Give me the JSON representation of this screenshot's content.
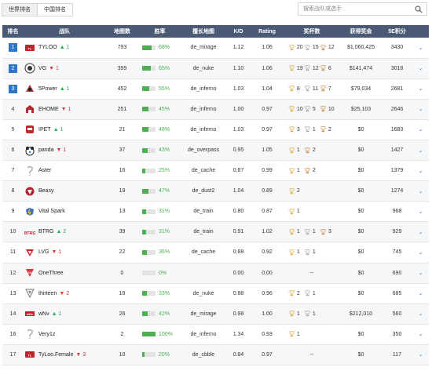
{
  "tabs": {
    "world": "世界排名",
    "china": "中国排名"
  },
  "search": {
    "placeholder": "搜索战队或选手"
  },
  "columns": {
    "rank": "排名",
    "team": "战队",
    "maps": "地图数",
    "winrate": "胜率",
    "best_map": "擅长地图",
    "kd": "K/D",
    "rating": "Rating",
    "trophies": "奖杯数",
    "prize": "获得奖金",
    "points": "5E积分"
  },
  "colors": {
    "header_bg": "#4a5a75",
    "rank_badge": "#2e76c6",
    "up": "#2fa84f",
    "down": "#d83a3a",
    "winrate": "#4caf50"
  },
  "rows": [
    {
      "rank": "1",
      "badge": true,
      "team": "TYLOO",
      "logo": "tyloo-logo",
      "trend": "up",
      "change": "1",
      "maps": "793",
      "winrate": "68%",
      "wr_value": 0.68,
      "map": "de_mirage",
      "kd": "1.12",
      "rating": "1.06",
      "trophies": [
        {
          "c": "gold",
          "n": "20"
        },
        {
          "c": "silver",
          "n": "15"
        },
        {
          "c": "bronze",
          "n": "12"
        }
      ],
      "prize": "$1,060,425",
      "points": "3430"
    },
    {
      "rank": "2",
      "badge": true,
      "team": "VG",
      "logo": "vg-logo",
      "trend": "down",
      "change": "1",
      "maps": "399",
      "winrate": "65%",
      "wr_value": 0.65,
      "map": "de_nuke",
      "kd": "1.10",
      "rating": "1.06",
      "trophies": [
        {
          "c": "gold",
          "n": "19"
        },
        {
          "c": "silver",
          "n": "12"
        },
        {
          "c": "bronze",
          "n": "6"
        }
      ],
      "prize": "$141,474",
      "points": "3018"
    },
    {
      "rank": "3",
      "badge": true,
      "team": "5Power",
      "logo": "5power-logo",
      "trend": "up",
      "change": "1",
      "maps": "452",
      "winrate": "55%",
      "wr_value": 0.55,
      "map": "de_inferno",
      "kd": "1.03",
      "rating": "1.04",
      "trophies": [
        {
          "c": "gold",
          "n": "8"
        },
        {
          "c": "silver",
          "n": "11"
        },
        {
          "c": "bronze",
          "n": "7"
        }
      ],
      "prize": "$79,034",
      "points": "2681"
    },
    {
      "rank": "4",
      "badge": false,
      "team": "EHOME",
      "logo": "ehome-logo",
      "trend": "down",
      "change": "1",
      "maps": "251",
      "winrate": "45%",
      "wr_value": 0.45,
      "map": "de_inferno",
      "kd": "1.00",
      "rating": "0.97",
      "trophies": [
        {
          "c": "gold",
          "n": "10"
        },
        {
          "c": "silver",
          "n": "5"
        },
        {
          "c": "bronze",
          "n": "10"
        }
      ],
      "prize": "$25,103",
      "points": "2646"
    },
    {
      "rank": "5",
      "badge": false,
      "team": "IPET",
      "logo": "ipet-logo",
      "trend": "up",
      "change": "1",
      "maps": "21",
      "winrate": "48%",
      "wr_value": 0.48,
      "map": "de_inferno",
      "kd": "1.03",
      "rating": "0.97",
      "trophies": [
        {
          "c": "gold",
          "n": "3"
        },
        {
          "c": "silver",
          "n": "1"
        },
        {
          "c": "bronze",
          "n": "2"
        }
      ],
      "prize": "$0",
      "points": "1683"
    },
    {
      "rank": "6",
      "badge": false,
      "team": "panda",
      "logo": "panda-logo",
      "trend": "down",
      "change": "1",
      "maps": "37",
      "winrate": "43%",
      "wr_value": 0.43,
      "map": "de_overpass",
      "kd": "0.95",
      "rating": "1.05",
      "trophies": [
        {
          "c": "gold",
          "n": "1"
        },
        {
          "c": "bronze",
          "n": "2"
        }
      ],
      "prize": "$0",
      "points": "1427"
    },
    {
      "rank": "7",
      "badge": false,
      "team": "Aster",
      "logo": "aster-logo",
      "trend": "",
      "change": "",
      "maps": "16",
      "winrate": "25%",
      "wr_value": 0.25,
      "map": "de_cache",
      "kd": "0.87",
      "rating": "0.99",
      "trophies": [
        {
          "c": "gold",
          "n": "1"
        },
        {
          "c": "bronze",
          "n": "2"
        }
      ],
      "prize": "$0",
      "points": "1379"
    },
    {
      "rank": "8",
      "badge": false,
      "team": "Beasy",
      "logo": "beasy-logo",
      "trend": "",
      "change": "",
      "maps": "19",
      "winrate": "47%",
      "wr_value": 0.47,
      "map": "de_dust2",
      "kd": "1.04",
      "rating": "0.89",
      "trophies": [
        {
          "c": "gold",
          "n": "2"
        }
      ],
      "prize": "$0",
      "points": "1274"
    },
    {
      "rank": "9",
      "badge": false,
      "team": "Vital Spark",
      "logo": "vitalspark-logo",
      "trend": "",
      "change": "",
      "maps": "13",
      "winrate": "31%",
      "wr_value": 0.31,
      "map": "de_train",
      "kd": "0.80",
      "rating": "0.87",
      "trophies": [
        {
          "c": "gold",
          "n": "1"
        }
      ],
      "prize": "$0",
      "points": "968"
    },
    {
      "rank": "10",
      "badge": false,
      "team": "BTRG",
      "logo": "btrg-logo",
      "trend": "up",
      "change": "2",
      "maps": "39",
      "winrate": "31%",
      "wr_value": 0.31,
      "map": "de_train",
      "kd": "0.91",
      "rating": "1.02",
      "trophies": [
        {
          "c": "gold",
          "n": "1"
        },
        {
          "c": "silver",
          "n": "1"
        },
        {
          "c": "bronze",
          "n": "3"
        }
      ],
      "prize": "$0",
      "points": "929"
    },
    {
      "rank": "11",
      "badge": false,
      "team": "LVG",
      "logo": "lvg-logo",
      "trend": "down",
      "change": "1",
      "maps": "22",
      "winrate": "36%",
      "wr_value": 0.36,
      "map": "de_cache",
      "kd": "0.88",
      "rating": "0.92",
      "trophies": [
        {
          "c": "gold",
          "n": "1"
        },
        {
          "c": "silver",
          "n": "1"
        }
      ],
      "prize": "$0",
      "points": "745"
    },
    {
      "rank": "12",
      "badge": false,
      "team": "OneThree",
      "logo": "onethree-logo",
      "trend": "",
      "change": "",
      "maps": "0",
      "winrate": "0%",
      "wr_value": 0,
      "map": "",
      "kd": "0.00",
      "rating": "0.00",
      "trophies_text": "--",
      "trophies": [],
      "prize": "$0",
      "points": "690"
    },
    {
      "rank": "13",
      "badge": false,
      "team": "thirteen",
      "logo": "thirteen-logo",
      "trend": "down",
      "change": "2",
      "maps": "18",
      "winrate": "33%",
      "wr_value": 0.33,
      "map": "de_nuke",
      "kd": "0.88",
      "rating": "0.96",
      "trophies": [
        {
          "c": "gold",
          "n": "2"
        },
        {
          "c": "silver",
          "n": "1"
        }
      ],
      "prize": "$0",
      "points": "685"
    },
    {
      "rank": "14",
      "badge": false,
      "team": "wNv",
      "logo": "wnv-logo",
      "trend": "up",
      "change": "1",
      "maps": "26",
      "winrate": "42%",
      "wr_value": 0.42,
      "map": "de_mirage",
      "kd": "0.98",
      "rating": "1.00",
      "trophies": [
        {
          "c": "gold",
          "n": "1"
        },
        {
          "c": "silver",
          "n": "1"
        }
      ],
      "prize": "$212,010",
      "points": "560"
    },
    {
      "rank": "16",
      "badge": false,
      "team": "Very1z",
      "logo": "very1z-logo",
      "trend": "",
      "change": "",
      "maps": "2",
      "winrate": "100%",
      "wr_value": 1.0,
      "map": "de_inferno",
      "kd": "1.34",
      "rating": "0.93",
      "trophies": [
        {
          "c": "gold",
          "n": "1"
        }
      ],
      "prize": "$0",
      "points": "350"
    },
    {
      "rank": "17",
      "badge": false,
      "team": "TyLoo.Female",
      "logo": "tyloo-female-logo",
      "trend": "down",
      "change": "3",
      "maps": "10",
      "winrate": "20%",
      "wr_value": 0.2,
      "map": "de_cbble",
      "kd": "0.84",
      "rating": "0.97",
      "trophies_text": "--",
      "trophies": [],
      "prize": "$0",
      "points": "117"
    }
  ]
}
